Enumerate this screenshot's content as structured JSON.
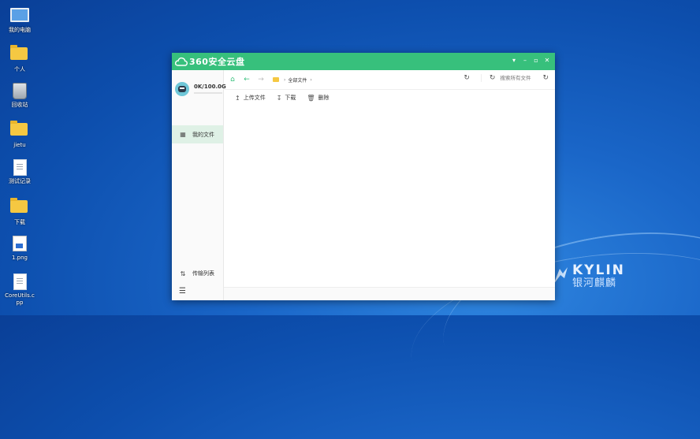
{
  "desktop": {
    "icons": [
      {
        "label": "我的电脑",
        "icon": "computer-icon"
      },
      {
        "label": "个人",
        "icon": "folder-icon"
      },
      {
        "label": "回收站",
        "icon": "trash-icon"
      },
      {
        "label": "jietu",
        "icon": "folder-icon"
      },
      {
        "label": "测试记录",
        "icon": "document-icon"
      },
      {
        "label": "下载",
        "icon": "folder-icon"
      },
      {
        "label": "1.png",
        "icon": "image-file-icon"
      },
      {
        "label": "CoreUtils.cpp",
        "icon": "document-icon"
      }
    ],
    "brand_en": "KYLIN",
    "brand_cn": "银河麒麟"
  },
  "window": {
    "title": "360安全云盘",
    "accent": "#37c07c",
    "controls": [
      "▾",
      "–",
      "▫",
      "✕"
    ]
  },
  "sidebar": {
    "quota_text": "0K/100.0G",
    "quota_fraction": 0.0,
    "nav_my_files": "我的文件",
    "transfer_list": "传输列表"
  },
  "addressbar": {
    "breadcrumb_root": "全部文件",
    "search_placeholder": "搜索所有文件"
  },
  "toolbar": {
    "upload": "上传文件",
    "download": "下载",
    "delete": "删除"
  }
}
